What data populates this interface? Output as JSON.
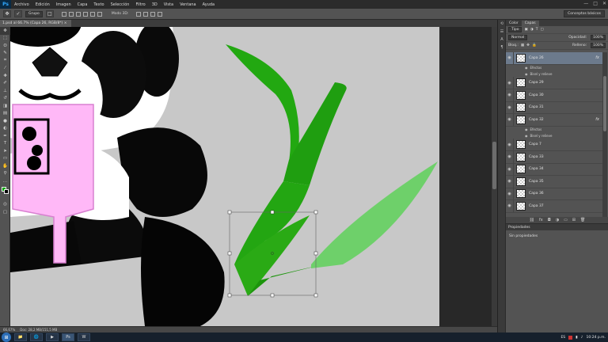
{
  "app": {
    "logo": "Ps"
  },
  "menu": [
    "Archivo",
    "Edición",
    "Imagen",
    "Capa",
    "Texto",
    "Selección",
    "Filtro",
    "3D",
    "Vista",
    "Ventana",
    "Ayuda"
  ],
  "window_controls": {
    "minimize": "—",
    "maximize": "□",
    "close": "✕"
  },
  "options": {
    "auto_select_value": "Grupo",
    "mode_3d_label": "Modo 3D:",
    "workspace": "Conceptos básicos"
  },
  "document": {
    "tab_title": "1.psd al 66.7% (Capa 26, RGB/8*) ×"
  },
  "canvas": {
    "bg_color": "#c8c8c8",
    "leaf_dark": "#22a811",
    "leaf_light": "#6ed06a",
    "phone_color": "#ffb8f7"
  },
  "status": {
    "zoom": "66,67%",
    "doc": "Doc: 28,2 MB/151,5 MB"
  },
  "panels": {
    "tab_color": "Color",
    "tab_layers": "Capas",
    "filter_kind": "Tipo",
    "blend_mode": "Normal",
    "opacity_label": "Opacidad:",
    "opacity_value": "100%",
    "lock_label": "Bloq.:",
    "fill_label": "Relleno:",
    "fill_value": "100%",
    "props_title": "Propiedades",
    "props_empty": "Sin propiedades"
  },
  "layers": [
    {
      "name": "Capa 26",
      "selected": true,
      "fx": true,
      "effects": [
        "Efectos",
        "Bisel y relieve"
      ]
    },
    {
      "name": "Capa 29",
      "selected": false,
      "fx": false,
      "effects": []
    },
    {
      "name": "Capa 30",
      "selected": false,
      "fx": false,
      "effects": []
    },
    {
      "name": "Capa 31",
      "selected": false,
      "fx": false,
      "effects": []
    },
    {
      "name": "Capa 32",
      "selected": false,
      "fx": true,
      "effects": [
        "Efectos",
        "Bisel y relieve"
      ]
    },
    {
      "name": "Capa 7",
      "selected": false,
      "fx": false,
      "effects": []
    },
    {
      "name": "Capa 33",
      "selected": false,
      "fx": false,
      "effects": []
    },
    {
      "name": "Capa 34",
      "selected": false,
      "fx": false,
      "effects": []
    },
    {
      "name": "Capa 35",
      "selected": false,
      "fx": false,
      "effects": []
    },
    {
      "name": "Capa 36",
      "selected": false,
      "fx": false,
      "effects": []
    },
    {
      "name": "Capa 37",
      "selected": false,
      "fx": false,
      "effects": []
    }
  ],
  "taskbar": {
    "lang": "ES",
    "time": "10:24 p.m.",
    "apps": [
      "📁",
      "🌐",
      "▶",
      "Ps",
      "W"
    ]
  }
}
